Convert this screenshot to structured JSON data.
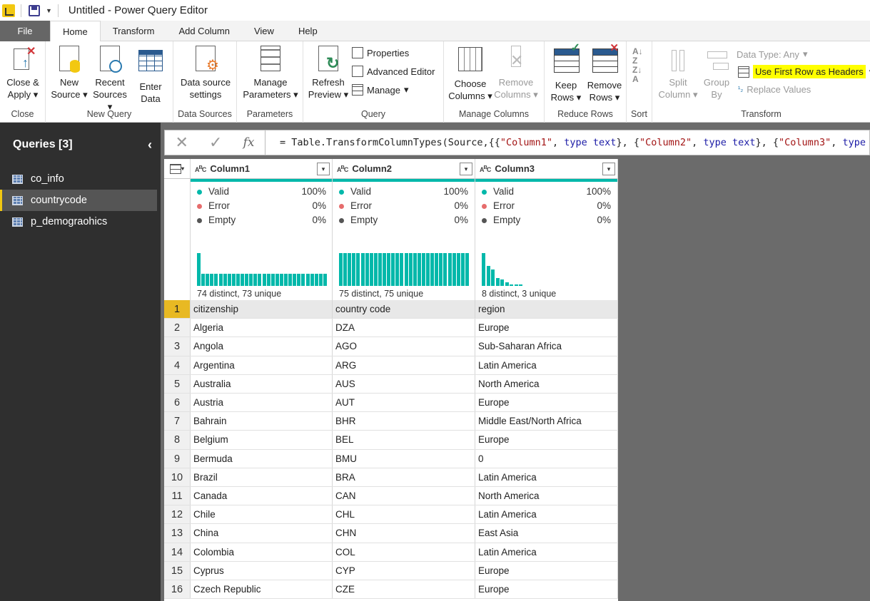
{
  "app": {
    "title": "Untitled - Power Query Editor"
  },
  "tabs": [
    {
      "label": "File"
    },
    {
      "label": "Home"
    },
    {
      "label": "Transform"
    },
    {
      "label": "Add Column"
    },
    {
      "label": "View"
    },
    {
      "label": "Help"
    }
  ],
  "ribbon": {
    "close": {
      "line1": "Close &",
      "line2": "Apply",
      "group": "Close"
    },
    "new_source": {
      "line1": "New",
      "line2": "Source"
    },
    "recent_sources": {
      "line1": "Recent",
      "line2": "Sources"
    },
    "enter_data": {
      "line1": "Enter",
      "line2": "Data",
      "group": "New Query"
    },
    "data_source_settings": {
      "line1": "Data source",
      "line2": "settings",
      "group": "Data Sources"
    },
    "manage_parameters": {
      "line1": "Manage",
      "line2": "Parameters",
      "group": "Parameters"
    },
    "refresh_preview": {
      "line1": "Refresh",
      "line2": "Preview"
    },
    "properties": "Properties",
    "advanced_editor": "Advanced Editor",
    "manage": "Manage",
    "query_group": "Query",
    "choose_columns": {
      "line1": "Choose",
      "line2": "Columns"
    },
    "remove_columns": {
      "line1": "Remove",
      "line2": "Columns",
      "group": "Manage Columns"
    },
    "keep_rows": {
      "line1": "Keep",
      "line2": "Rows"
    },
    "remove_rows": {
      "line1": "Remove",
      "line2": "Rows",
      "group": "Reduce Rows"
    },
    "sort_group": "Sort",
    "split_column": {
      "line1": "Split",
      "line2": "Column"
    },
    "group_by": {
      "line1": "Group",
      "line2": "By"
    },
    "data_type": "Data Type: Any",
    "use_first_row": "Use First Row as Headers",
    "replace_values": "Replace Values",
    "transform_group": "Transform"
  },
  "sidebar": {
    "title": "Queries [3]",
    "queries": [
      {
        "name": "co_info"
      },
      {
        "name": "countrycode"
      },
      {
        "name": "p_demograohics"
      }
    ]
  },
  "formula": {
    "p1": "= Table.TransformColumnTypes(Source,{{",
    "s1": "\"Column1\"",
    "c1": ", ",
    "k1": "type text",
    "p2": "}, {",
    "s2": "\"Column2\"",
    "c2": ", ",
    "k2": "type text",
    "p3": "}, {",
    "s3": "\"Column3\"",
    "c3": ", ",
    "k3": "type"
  },
  "columns": [
    {
      "name": "Column1",
      "type": "ABC",
      "valid": "100%",
      "error": "0%",
      "empty": "0%",
      "distinct": "74 distinct, 73 unique",
      "hist": [
        1,
        0.38,
        0.38,
        0.38,
        0.38,
        0.38,
        0.38,
        0.38,
        0.38,
        0.38,
        0.38,
        0.38,
        0.38,
        0.38,
        0.38,
        0.38,
        0.38,
        0.38,
        0.38,
        0.38,
        0.38,
        0.38,
        0.38,
        0.38,
        0.38,
        0.38,
        0.38,
        0.38,
        0.38,
        0.38
      ]
    },
    {
      "name": "Column2",
      "type": "ABC",
      "valid": "100%",
      "error": "0%",
      "empty": "0%",
      "distinct": "75 distinct, 75 unique",
      "hist": [
        1,
        1,
        1,
        1,
        1,
        1,
        1,
        1,
        1,
        1,
        1,
        1,
        1,
        1,
        1,
        1,
        1,
        1,
        1,
        1,
        1,
        1,
        1,
        1,
        1,
        1,
        1,
        1,
        1,
        1
      ]
    },
    {
      "name": "Column3",
      "type": "ABC",
      "valid": "100%",
      "error": "0%",
      "empty": "0%",
      "distinct": "8 distinct, 3 unique",
      "hist": [
        1,
        0.6,
        0.5,
        0.25,
        0.2,
        0.1,
        0.05,
        0.05,
        0.05
      ]
    }
  ],
  "labels": {
    "valid": "Valid",
    "error": "Error",
    "empty": "Empty"
  },
  "rows": [
    {
      "n": "1",
      "c1": "citizenship",
      "c2": "country code",
      "c3": "region"
    },
    {
      "n": "2",
      "c1": "Algeria",
      "c2": "DZA",
      "c3": "Europe"
    },
    {
      "n": "3",
      "c1": "Angola",
      "c2": "AGO",
      "c3": "Sub-Saharan Africa"
    },
    {
      "n": "4",
      "c1": "Argentina",
      "c2": "ARG",
      "c3": "Latin America"
    },
    {
      "n": "5",
      "c1": "Australia",
      "c2": "AUS",
      "c3": "North America"
    },
    {
      "n": "6",
      "c1": "Austria",
      "c2": "AUT",
      "c3": "Europe"
    },
    {
      "n": "7",
      "c1": "Bahrain",
      "c2": "BHR",
      "c3": "Middle East/North Africa"
    },
    {
      "n": "8",
      "c1": "Belgium",
      "c2": "BEL",
      "c3": "Europe"
    },
    {
      "n": "9",
      "c1": "Bermuda",
      "c2": "BMU",
      "c3": "0"
    },
    {
      "n": "10",
      "c1": "Brazil",
      "c2": "BRA",
      "c3": "Latin America"
    },
    {
      "n": "11",
      "c1": "Canada",
      "c2": "CAN",
      "c3": "North America"
    },
    {
      "n": "12",
      "c1": "Chile",
      "c2": "CHL",
      "c3": "Latin America"
    },
    {
      "n": "13",
      "c1": "China",
      "c2": "CHN",
      "c3": "East Asia"
    },
    {
      "n": "14",
      "c1": "Colombia",
      "c2": "COL",
      "c3": "Latin America"
    },
    {
      "n": "15",
      "c1": "Cyprus",
      "c2": "CYP",
      "c3": "Europe"
    },
    {
      "n": "16",
      "c1": "Czech Republic",
      "c2": "CZE",
      "c3": "Europe"
    }
  ],
  "colors": {
    "accent": "#01b8aa",
    "highlight": "#ffff00",
    "selected_row": "#e8b923",
    "sidebar": "#2f2f2f"
  }
}
